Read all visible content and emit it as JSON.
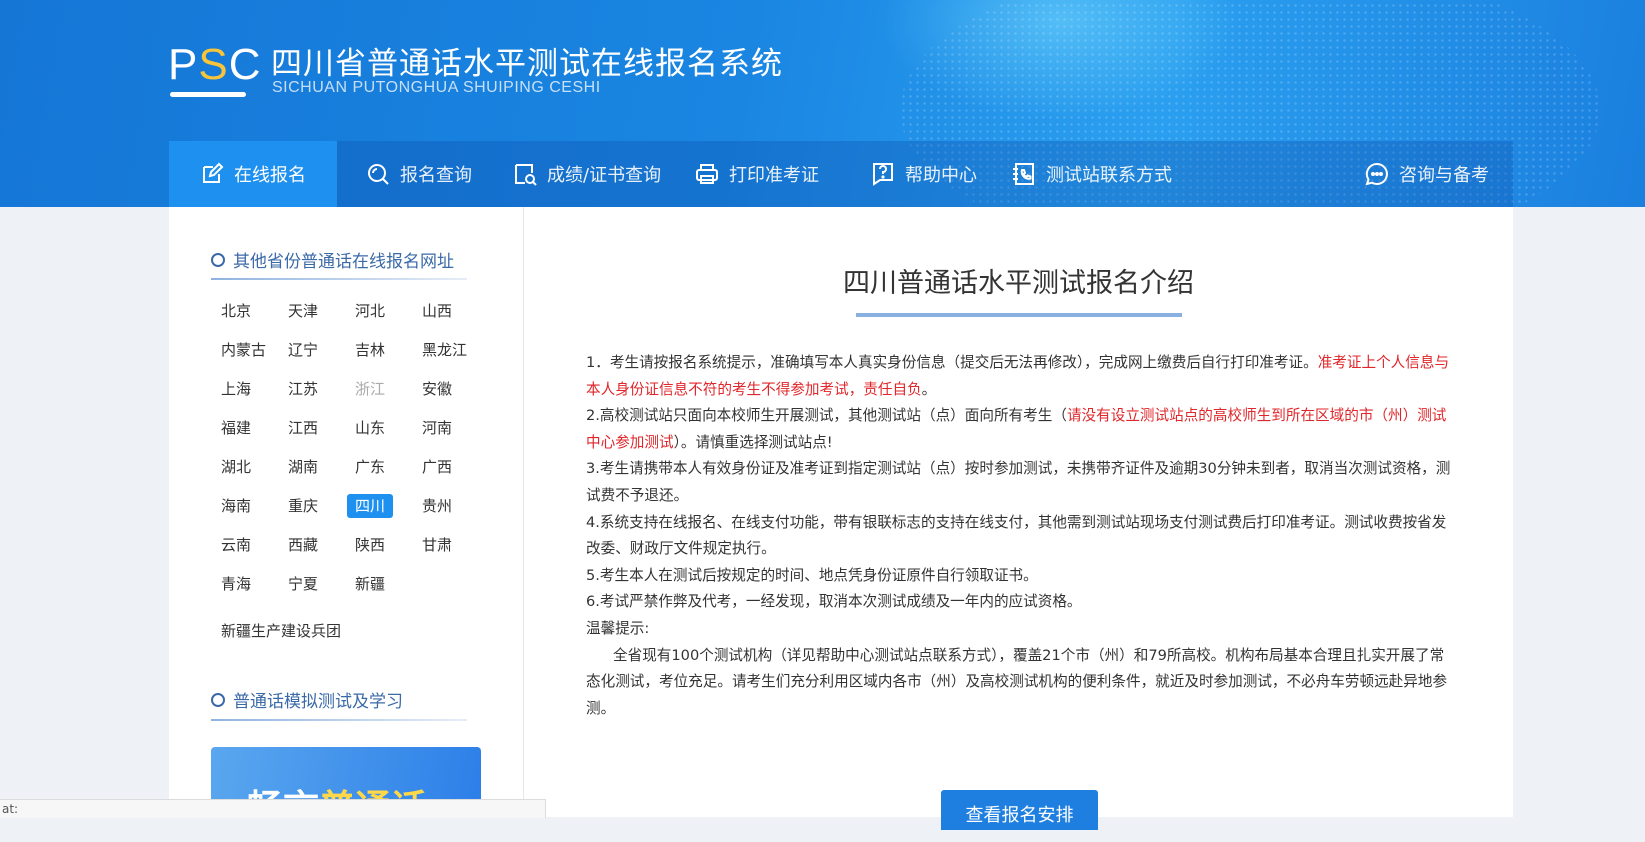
{
  "header": {
    "logo_text_p": "P",
    "logo_text_s": "S",
    "logo_text_c": "C",
    "title": "四川省普通话水平测试在线报名系统",
    "subtitle": "SICHUAN PUTONGHUA SHUIPING CESHI"
  },
  "nav": {
    "items": [
      {
        "label": "在线报名",
        "icon": "edit-icon"
      },
      {
        "label": "报名查询",
        "icon": "search-icon"
      },
      {
        "label": "成绩/证书查询",
        "icon": "certificate-search-icon"
      },
      {
        "label": "打印准考证",
        "icon": "printer-icon"
      },
      {
        "label": "帮助中心",
        "icon": "help-icon"
      },
      {
        "label": "测试站联系方式",
        "icon": "phone-book-icon"
      },
      {
        "label": "咨询与备考",
        "icon": "chat-icon"
      }
    ],
    "active_index": 0
  },
  "sidebar": {
    "provinces_heading": "其他省份普通话在线报名网址",
    "provinces": [
      "北京",
      "天津",
      "河北",
      "山西",
      "内蒙古",
      "辽宁",
      "吉林",
      "黑龙江",
      "上海",
      "江苏",
      "浙江",
      "安徽",
      "福建",
      "江西",
      "山东",
      "河南",
      "湖北",
      "湖南",
      "广东",
      "广西",
      "海南",
      "重庆",
      "四川",
      "贵州",
      "云南",
      "西藏",
      "陕西",
      "甘肃",
      "青海",
      "宁夏",
      "新疆"
    ],
    "active_province": "四川",
    "muted_province": "浙江",
    "extra_item": "新疆生产建设兵团",
    "study_heading": "普通话模拟测试及学习",
    "promo_text_a": "畅言",
    "promo_text_b": "普通话"
  },
  "main": {
    "title": "四川普通话水平测试报名介绍",
    "item1_a": "1．考生请按报名系统提示，准确填写本人真实身份信息（提交后无法再修改），完成网上缴费后自行打印准考证。",
    "item1_red": "准考证上个人信息与本人身份证信息不符的考生不得参加考试，责任自负",
    "item1_end": "。",
    "item2_a": "2.高校测试站只面向本校师生开展测试，其他测试站（点）面向所有考生（",
    "item2_red": "请没有设立测试站点的高校师生到所在区域的市（州）测试中心参加测试",
    "item2_end": "）。请慎重选择测试站点!",
    "item3": "3.考生请携带本人有效身份证及准考证到指定测试站（点）按时参加测试，未携带齐证件及逾期30分钟未到者，取消当次测试资格，测试费不予退还。",
    "item4": "4.系统支持在线报名、在线支付功能，带有银联标志的支持在线支付，其他需到测试站现场支付测试费后打印准考证。测试收费按省发改委、财政厅文件规定执行。",
    "item5": "5.考生本人在测试后按规定的时间、地点凭身份证原件自行领取证书。",
    "item6": "6.考试严禁作弊及代考，一经发现，取消本次测试成绩及一年内的应试资格。",
    "tip_label": "温馨提示:",
    "tip_body": "全省现有100个测试机构（详见帮助中心测试站点联系方式），覆盖21个市（州）和79所高校。机构布局基本合理且扎实开展了常态化测试，考位充足。请考生们充分利用区域内各市（州）及高校测试机构的便利条件，就近及时参加测试，不必舟车劳顿远赴异地参测。",
    "cta_label": "查看报名安排"
  },
  "status_bar": {
    "text": "at:"
  },
  "colors": {
    "primary": "#1e90f0",
    "header_bg": "#1576d6",
    "warning_red": "#e0262a",
    "accent_yellow": "#f7c43a"
  }
}
